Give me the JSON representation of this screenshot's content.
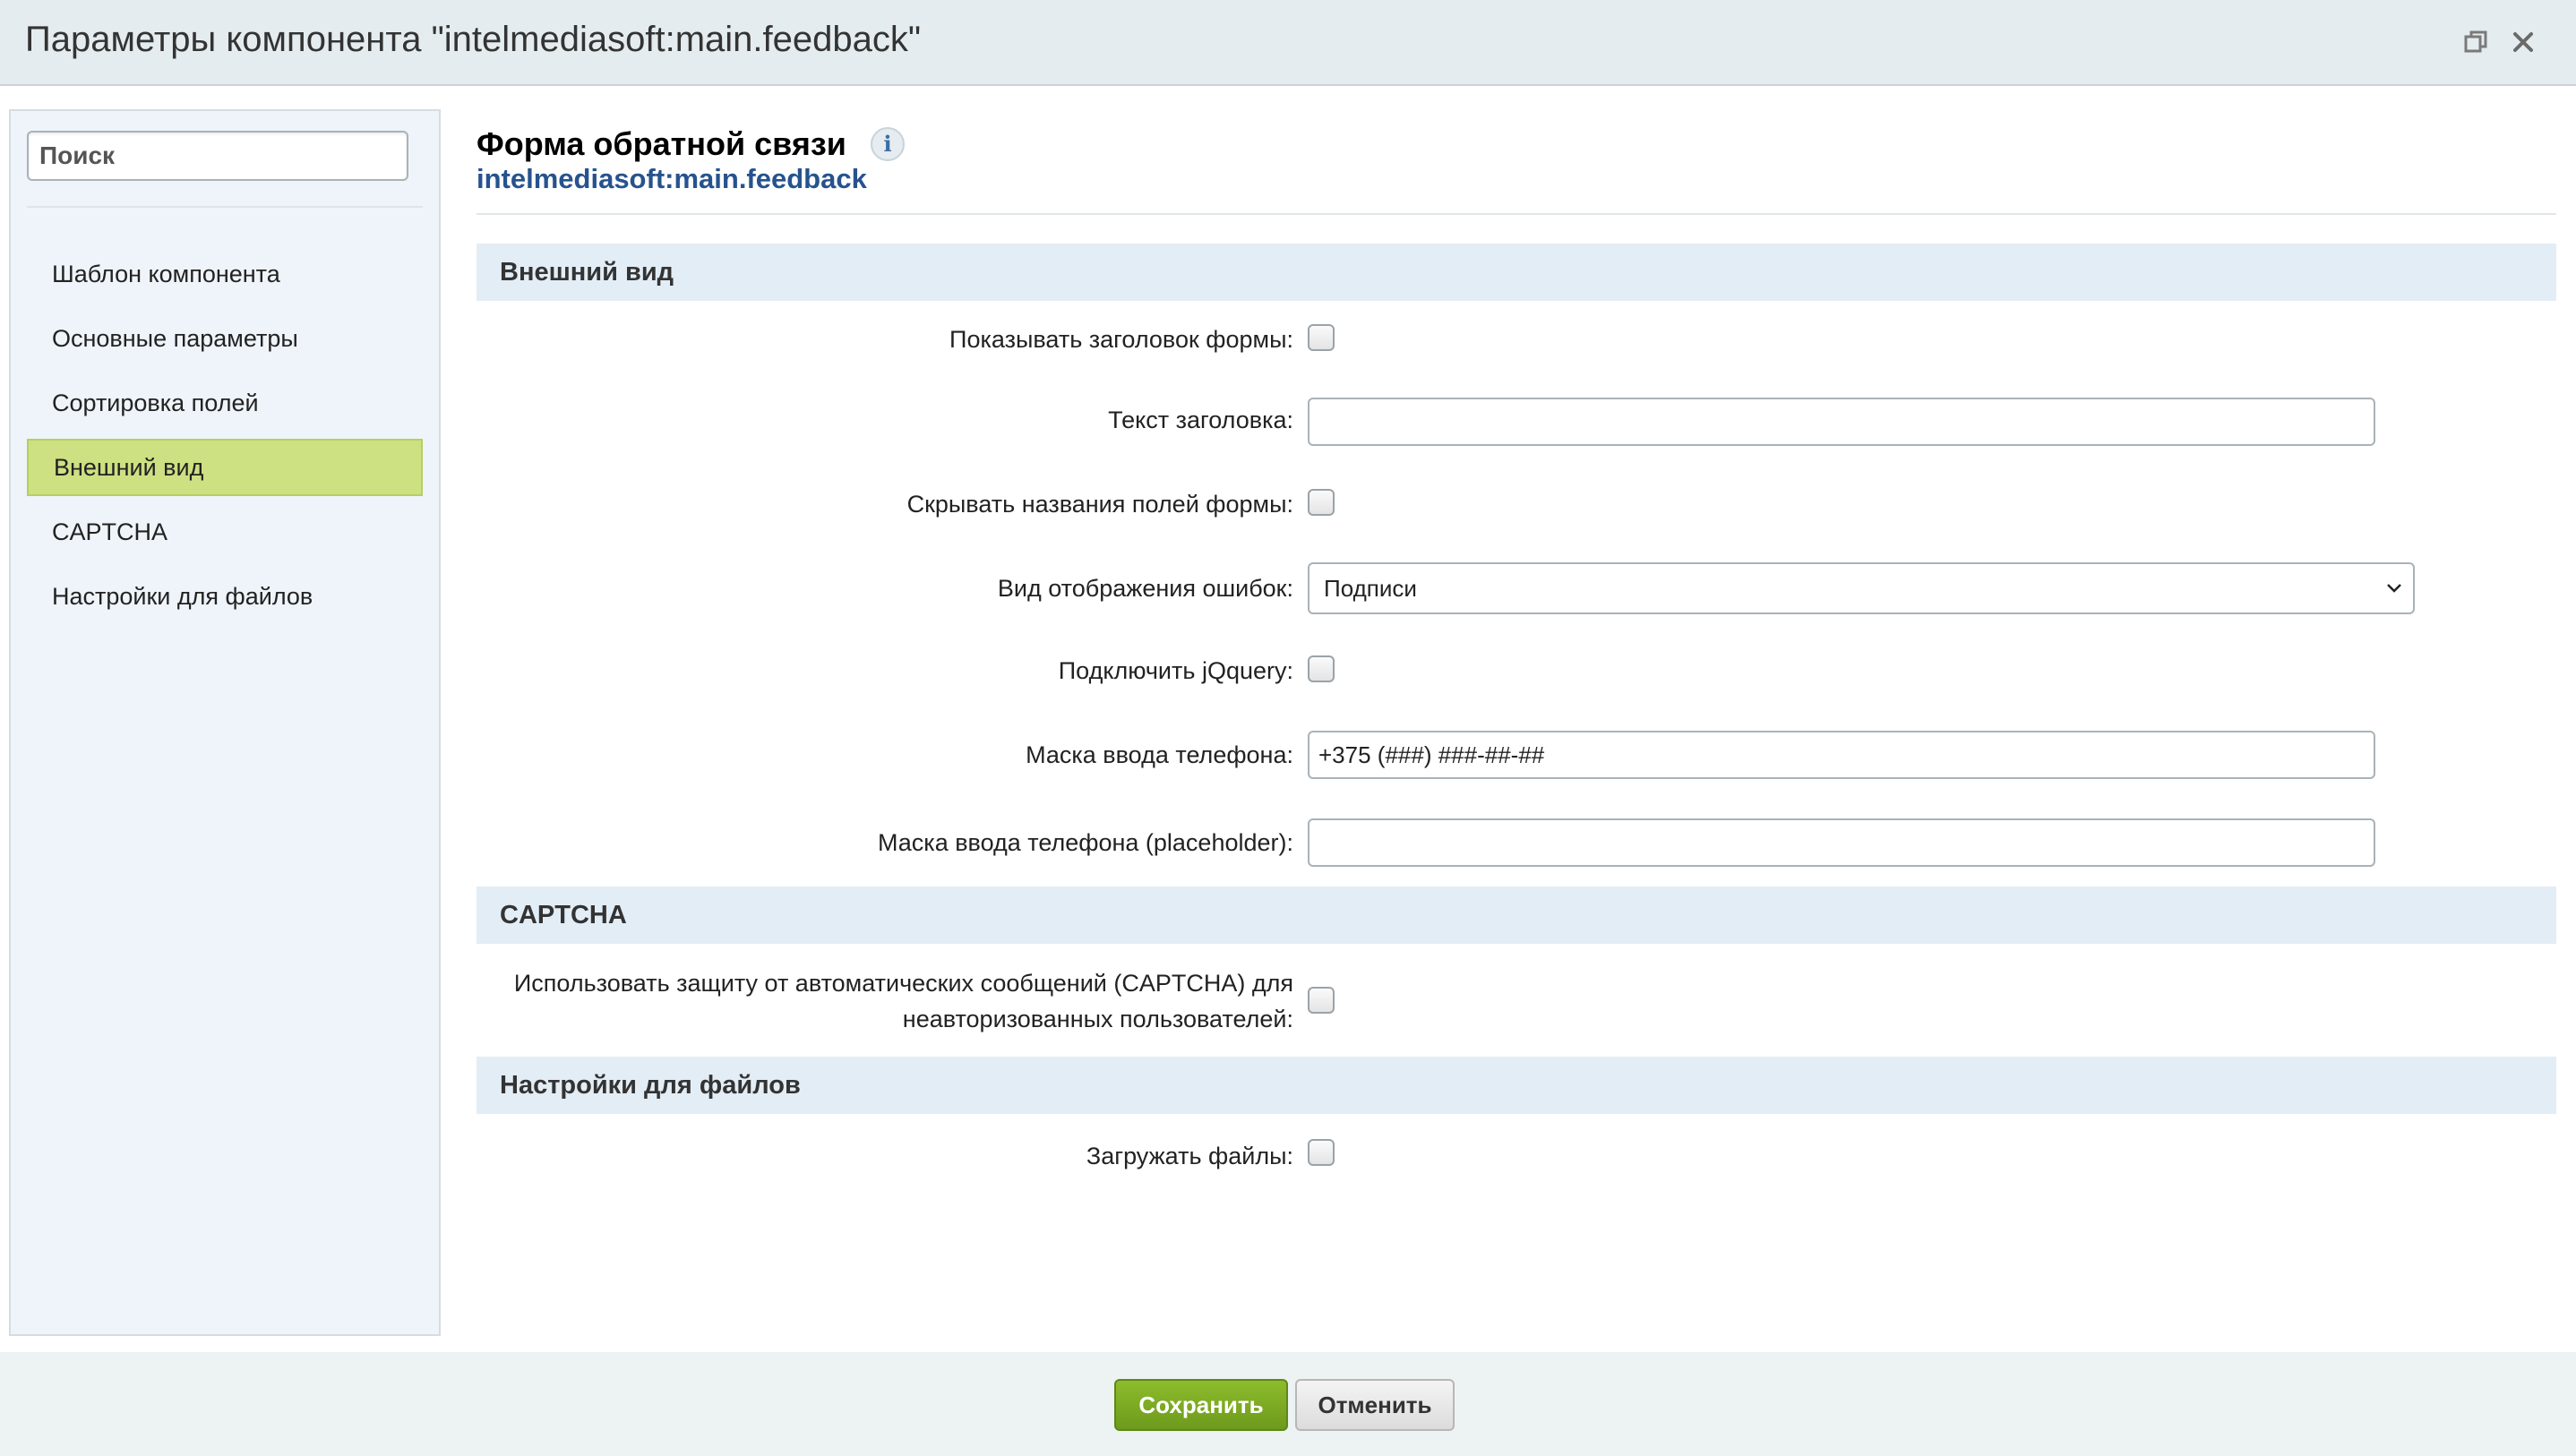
{
  "window": {
    "title": "Параметры компонента \"intelmediasoft:main.feedback\"",
    "restore_icon": "restore-window-icon",
    "close_icon": "close-icon"
  },
  "sidebar": {
    "search_placeholder": "Поиск",
    "items": [
      {
        "label": "Шаблон компонента",
        "active": false
      },
      {
        "label": "Основные параметры",
        "active": false
      },
      {
        "label": "Сортировка полей",
        "active": false
      },
      {
        "label": "Внешний вид",
        "active": true
      },
      {
        "label": "CAPTCHA",
        "active": false
      },
      {
        "label": "Настройки для файлов",
        "active": false
      }
    ]
  },
  "header": {
    "title": "Форма обратной связи",
    "info_icon": "info-icon",
    "info_glyph": "i",
    "subtitle": "intelmediasoft:main.feedback"
  },
  "sections": {
    "appearance": {
      "title": "Внешний вид",
      "show_title_label": "Показывать заголовок формы:",
      "show_title_checked": false,
      "title_text_label": "Текст заголовка:",
      "title_text_value": "",
      "hide_labels_label": "Скрывать названия полей формы:",
      "hide_labels_checked": false,
      "error_display_label": "Вид отображения ошибок:",
      "error_display_value": "Подписи",
      "jquery_label": "Подключить jQquery:",
      "jquery_checked": false,
      "phone_mask_label": "Маска ввода телефона:",
      "phone_mask_value": "+375 (###) ###-##-##",
      "phone_placeholder_label": "Маска ввода телефона (placeholder):",
      "phone_placeholder_value": ""
    },
    "captcha": {
      "title": "CAPTCHA",
      "use_captcha_label": "Использовать защиту от автоматических сообщений (CAPTCHA) для неавторизованных пользователей:",
      "use_captcha_checked": false
    },
    "files": {
      "title": "Настройки для файлов",
      "upload_label": "Загружать файлы:",
      "upload_checked": false
    }
  },
  "footer": {
    "save_label": "Сохранить",
    "cancel_label": "Отменить"
  },
  "colors": {
    "accent_active": "#cde082",
    "save_button": "#7aa823",
    "link_blue": "#26538e",
    "section_bg": "#e3edf6"
  }
}
